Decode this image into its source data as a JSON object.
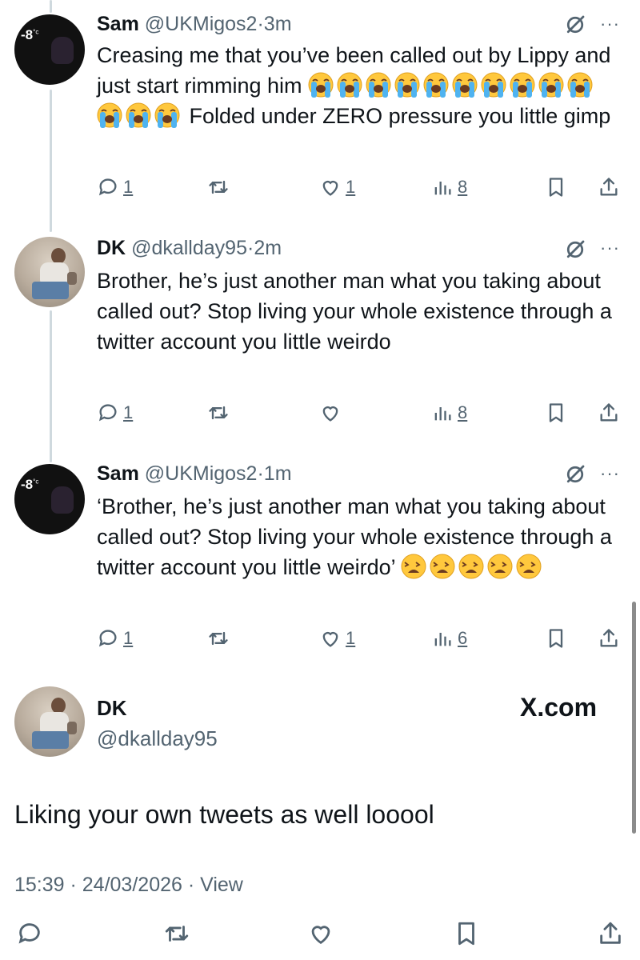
{
  "tweets": [
    {
      "name": "Sam",
      "handle": "@UKMigos2",
      "dot": "·",
      "time": "3m",
      "avatar_text": "-8",
      "avatar_unit": "°c",
      "text_1": "Creasing me that you’ve been called out by Lippy and just start rimming him ",
      "emoji_1": "loudly-crying-face",
      "emoji_1_count": 13,
      "text_2": " Folded under ZERO pressure you little gimp",
      "counts": {
        "reply": "1",
        "like": "1",
        "views": "8"
      }
    },
    {
      "name": "DK",
      "handle": "@dkallday95",
      "dot": "·",
      "time": "2m",
      "text": "Brother, he’s just another man what you taking about called out? Stop living your whole existence through a twitter account you little weirdo",
      "counts": {
        "reply": "1",
        "like": "",
        "views": "8"
      }
    },
    {
      "name": "Sam",
      "handle": "@UKMigos2",
      "dot": "·",
      "time": "1m",
      "avatar_text": "-8",
      "avatar_unit": "°c",
      "text_1": "‘Brother, he’s just another man what you taking about called out? Stop living your whole existence through a twitter account you little weirdo’ ",
      "emoji_1": "weary-face",
      "emoji_1_count": 5,
      "counts": {
        "reply": "1",
        "like": "1",
        "views": "6"
      }
    }
  ],
  "main_tweet": {
    "name": "DK",
    "handle": "@dkallday95",
    "brand": "X.com",
    "text": "Liking your own tweets as well looool",
    "timestamp": "15:39 · 24/03/2026 · View"
  },
  "colors": {
    "text": "#0f1419",
    "secondary": "#536471",
    "thread_line": "#cfd9de"
  },
  "icons": [
    "reply-icon",
    "retweet-icon",
    "like-icon",
    "views-icon",
    "bookmark-icon",
    "share-icon",
    "grok-icon",
    "more-icon"
  ]
}
